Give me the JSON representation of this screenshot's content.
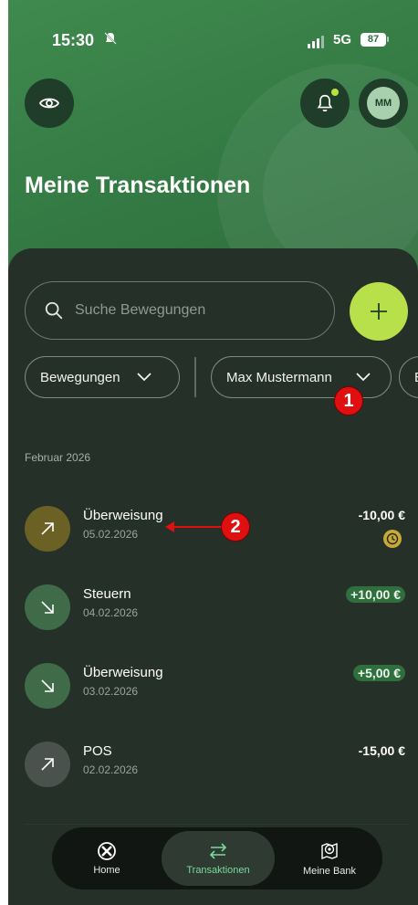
{
  "status": {
    "time": "15:30",
    "network": "5G",
    "battery": "87"
  },
  "header": {
    "title": "Meine Transaktionen",
    "avatar_initials": "MM"
  },
  "search": {
    "placeholder": "Suche Bewegungen"
  },
  "filters": [
    {
      "label": "Bewegungen"
    },
    {
      "label": "Max Mustermann"
    },
    {
      "label": "B"
    }
  ],
  "annotations": [
    "1",
    "2"
  ],
  "section": {
    "label": "Februar 2026"
  },
  "transactions": [
    {
      "title": "Überweisung",
      "date": "05.02.2026",
      "amount": "-10,00 €",
      "direction": "out",
      "pending": true,
      "color": "#6b6124"
    },
    {
      "title": "Steuern",
      "date": "04.02.2026",
      "amount": "+10,00 €",
      "direction": "in",
      "pending": false,
      "color": "#3f6b48"
    },
    {
      "title": "Überweisung",
      "date": "03.02.2026",
      "amount": "+5,00 €",
      "direction": "in",
      "pending": false,
      "color": "#3f6b48"
    },
    {
      "title": "POS",
      "date": "02.02.2026",
      "amount": "-15,00 €",
      "direction": "out",
      "pending": false,
      "color": "#4a524d"
    }
  ],
  "nav": {
    "home": "Home",
    "transactions": "Transaktionen",
    "bank": "Meine Bank"
  },
  "colors": {
    "brand_green": "#347a44",
    "accent_lime": "#b7e04a",
    "background": "#243028"
  }
}
